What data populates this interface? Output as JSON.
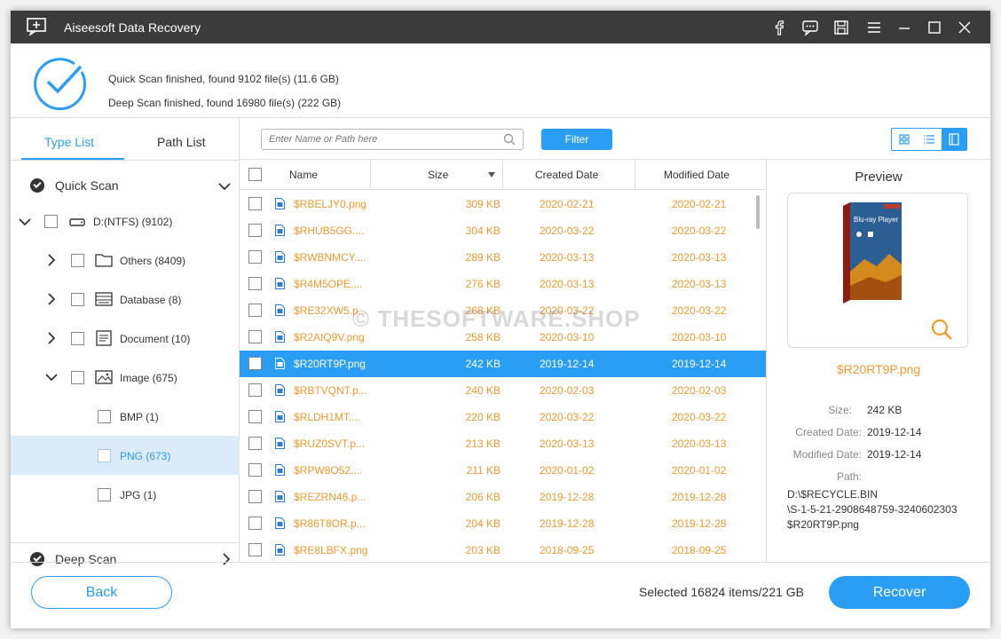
{
  "app": {
    "title": "Aiseesoft Data Recovery"
  },
  "status": {
    "quick": "Quick Scan finished, found 9102 file(s) (11.6 GB)",
    "deep": "Deep Scan finished, found 16980 file(s) (222 GB)"
  },
  "tabs": {
    "type_list": "Type List",
    "path_list": "Path List"
  },
  "tree": {
    "quick_scan": "Quick Scan",
    "drive": "D:(NTFS) (9102)",
    "nodes": [
      {
        "label": "Others (8409)",
        "icon": "folder-icon"
      },
      {
        "label": "Database (8)",
        "icon": "database-icon"
      },
      {
        "label": "Document (10)",
        "icon": "document-icon"
      },
      {
        "label": "Image (675)",
        "icon": "image-icon"
      }
    ],
    "image_children": [
      "BMP (1)",
      "PNG (673)",
      "JPG (1)"
    ],
    "deep_scan": "Deep Scan"
  },
  "search": {
    "placeholder": "Enter Name or Path here"
  },
  "filter_label": "Filter",
  "columns": {
    "name": "Name",
    "size": "Size",
    "created": "Created Date",
    "modified": "Modified Date"
  },
  "files": [
    {
      "name": "$RBELJY0.png",
      "size": "309 KB",
      "created": "2020-02-21",
      "modified": "2020-02-21"
    },
    {
      "name": "$RHUB5GG....",
      "size": "304 KB",
      "created": "2020-03-22",
      "modified": "2020-03-22"
    },
    {
      "name": "$RWBNMCY....",
      "size": "289 KB",
      "created": "2020-03-13",
      "modified": "2020-03-13"
    },
    {
      "name": "$R4M5OPE....",
      "size": "276 KB",
      "created": "2020-03-13",
      "modified": "2020-03-13"
    },
    {
      "name": "$RE32XW5.p...",
      "size": "268 KB",
      "created": "2020-03-22",
      "modified": "2020-03-22"
    },
    {
      "name": "$R2AIQ9V.png",
      "size": "258 KB",
      "created": "2020-03-10",
      "modified": "2020-03-10"
    },
    {
      "name": "$R20RT9P.png",
      "size": "242 KB",
      "created": "2019-12-14",
      "modified": "2019-12-14"
    },
    {
      "name": "$RBTVQNT.p...",
      "size": "240 KB",
      "created": "2020-02-03",
      "modified": "2020-02-03"
    },
    {
      "name": "$RLDH1MT....",
      "size": "220 KB",
      "created": "2020-03-22",
      "modified": "2020-03-22"
    },
    {
      "name": "$RUZ0SVT.p...",
      "size": "213 KB",
      "created": "2020-03-13",
      "modified": "2020-03-13"
    },
    {
      "name": "$RPW8O52....",
      "size": "211 KB",
      "created": "2020-01-02",
      "modified": "2020-01-02"
    },
    {
      "name": "$REZRN46.p...",
      "size": "206 KB",
      "created": "2019-12-28",
      "modified": "2019-12-28"
    },
    {
      "name": "$R86T8OR.p...",
      "size": "204 KB",
      "created": "2019-12-28",
      "modified": "2019-12-28"
    },
    {
      "name": "$RE8LBFX.png",
      "size": "203 KB",
      "created": "2018-09-25",
      "modified": "2018-09-25"
    }
  ],
  "selected_index": 6,
  "preview": {
    "title": "Preview",
    "box_text": "Blu-ray Player",
    "file_name": "$R20RT9P.png",
    "size_label": "Size:",
    "size": "242 KB",
    "created_label": "Created Date:",
    "created": "2019-12-14",
    "modified_label": "Modified Date:",
    "modified": "2019-12-14",
    "path_label": "Path:",
    "path_lines": [
      "D:\\$RECYCLE.BIN",
      "\\S-1-5-21-2908648759-3240602303",
      "$R20RT9P.png"
    ]
  },
  "watermark": "© THESOFTWARE.SHOP",
  "bottom": {
    "back": "Back",
    "selected": "Selected 16824 items/221 GB",
    "recover": "Recover"
  },
  "colors": {
    "accent": "#2a9df4",
    "file_text": "#f29a2e",
    "titlebar": "#3b3b3b"
  }
}
